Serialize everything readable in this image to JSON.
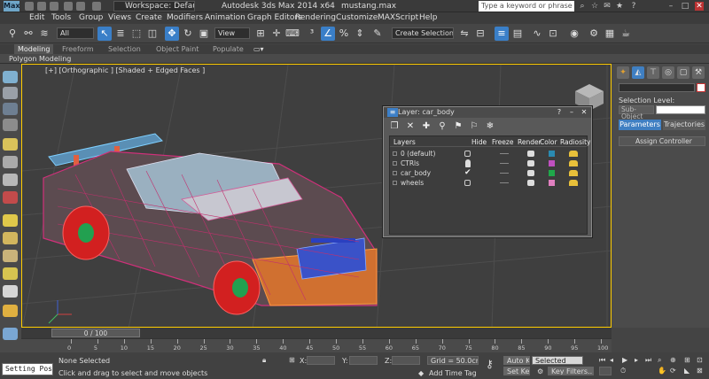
{
  "titlebar": {
    "workspace": "Workspace: Default",
    "app_title": "Autodesk 3ds Max  2014 x64",
    "file_name": "mustang.max",
    "search_placeholder": "Type a keyword or phrase"
  },
  "menu": [
    "Edit",
    "Tools",
    "Group",
    "Views",
    "Create",
    "Modifiers",
    "Animation",
    "Graph Editors",
    "Rendering",
    "Customize",
    "MAXScript",
    "Help"
  ],
  "toolbar": {
    "selection_filter": "All",
    "reference_coord": "View",
    "named_selection": "Create Selection Se"
  },
  "ribbon": {
    "tabs": [
      "Modeling",
      "Freeform",
      "Selection",
      "Object Paint",
      "Populate"
    ],
    "panel_label": "Polygon Modeling"
  },
  "viewport": {
    "label": "[+] [Orthographic ] [Shaded + Edged Faces ]"
  },
  "layer_dialog": {
    "title": "Layer: car_body",
    "columns": [
      "Layers",
      "Hide",
      "Freeze",
      "Render",
      "Color",
      "Radiosity"
    ],
    "layers": [
      {
        "name": "0 (default)",
        "hide": "box",
        "color": "#2a8ab0"
      },
      {
        "name": "CTRls",
        "hide": "bulb",
        "color": "#c050c0"
      },
      {
        "name": "car_body",
        "hide": "check",
        "color": "#1fa84a"
      },
      {
        "name": "wheels",
        "hide": "box",
        "color": "#e080c0"
      }
    ]
  },
  "command_panel": {
    "selection_level": "Selection Level:",
    "sub_object": "Sub-Object",
    "tab_parameters": "Parameters",
    "tab_trajectories": "Trajectories",
    "assign_controller": "Assign Controller"
  },
  "timeline": {
    "frame_display": "0 / 100",
    "ticks": [
      "0",
      "5",
      "10",
      "15",
      "20",
      "25",
      "30",
      "35",
      "40",
      "45",
      "50",
      "55",
      "60",
      "65",
      "70",
      "75",
      "80",
      "85",
      "90",
      "95",
      "100"
    ]
  },
  "status": {
    "listener": "Setting Posi",
    "selection": "None Selected",
    "prompt": "Click and drag to select and move objects",
    "x_label": "X:",
    "y_label": "Y:",
    "z_label": "Z:",
    "grid": "Grid = 50.0cm",
    "add_time_tag": "Add Time Tag",
    "auto_key": "Auto Key",
    "set_key": "Set Key",
    "selected_dropdown": "Selected",
    "key_filters": "Key Filters..."
  }
}
